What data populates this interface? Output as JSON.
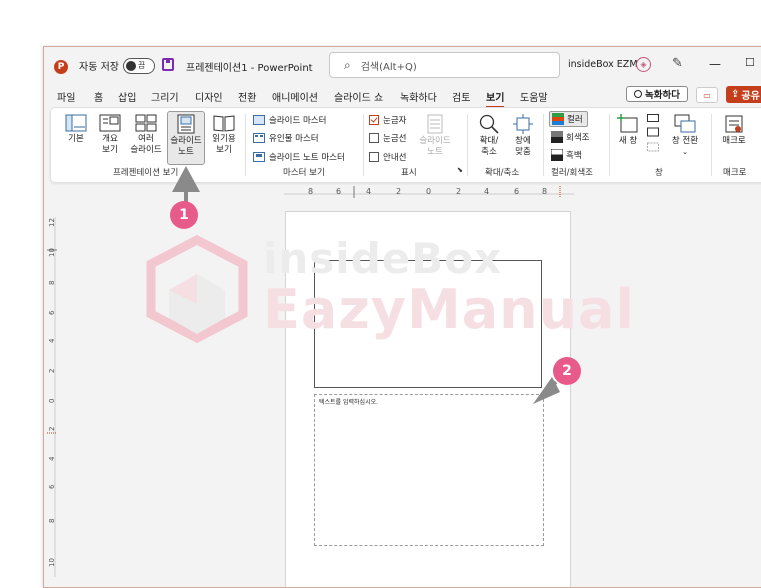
{
  "titlebar": {
    "autosave_label": "자동 저장",
    "autosave_state": "끔",
    "doc_title": "프레젠테이션1  -  PowerPoint",
    "search_placeholder": "검색(Alt+Q)",
    "account_name": "insideBox EZM",
    "minimize": "—",
    "maximize": "☐"
  },
  "tabs": [
    "파일",
    "홈",
    "삽입",
    "그리기",
    "디자인",
    "전환",
    "애니메이션",
    "슬라이드 쇼",
    "녹화하다",
    "검토",
    "보기",
    "도움말"
  ],
  "active_tab": "보기",
  "actions": {
    "record": "녹화하다",
    "share": "공유"
  },
  "ribbon": {
    "presentation_views": {
      "group_label": "프레젠테이션 보기",
      "normal": [
        "기본"
      ],
      "outline": [
        "개요",
        "보기"
      ],
      "slide_sorter": [
        "여러",
        "슬라이드"
      ],
      "notes_page": [
        "슬라이드",
        "노트"
      ],
      "reading": [
        "읽기용",
        "보기"
      ]
    },
    "master_views": {
      "group_label": "마스터 보기",
      "items": [
        "슬라이드 마스터",
        "유인물 마스터",
        "슬라이드 노트 마스터"
      ]
    },
    "show": {
      "group_label": "표시",
      "ruler": "눈금자",
      "ruler_checked": true,
      "gridlines": "눈금선",
      "gridlines_checked": false,
      "guides": "안내선",
      "guides_checked": false,
      "notes": [
        "슬라이드",
        "노트"
      ]
    },
    "zoom": {
      "group_label": "확대/축소",
      "zoom": [
        "확대/",
        "축소"
      ],
      "fit": [
        "창에",
        "맞춤"
      ]
    },
    "color": {
      "group_label": "컬러/회색조",
      "items": [
        "컬러",
        "회색조",
        "흑백"
      ]
    },
    "window": {
      "group_label": "창",
      "new_window": "새 창",
      "switch": "창 전환"
    },
    "macros": {
      "group_label": "매크로",
      "label": "매크로"
    }
  },
  "ruler_h_labels": [
    "8",
    "6",
    "4",
    "2",
    "0",
    "2",
    "4",
    "6",
    "8"
  ],
  "ruler_v_labels": [
    "12",
    "10",
    "8",
    "6",
    "4",
    "2",
    "0",
    "2",
    "4",
    "6",
    "8",
    "10"
  ],
  "notes_placeholder": "텍스트를 입력하십시오.",
  "watermark": {
    "line1": "insideBox",
    "line2": "EazyManual"
  },
  "badges": [
    "1",
    "2"
  ],
  "colors": {
    "accent": "#c43e1c",
    "badge": "#e85a8a",
    "ribbon_bg": "#ffffff",
    "chrome_bg": "#f3f3f3"
  }
}
